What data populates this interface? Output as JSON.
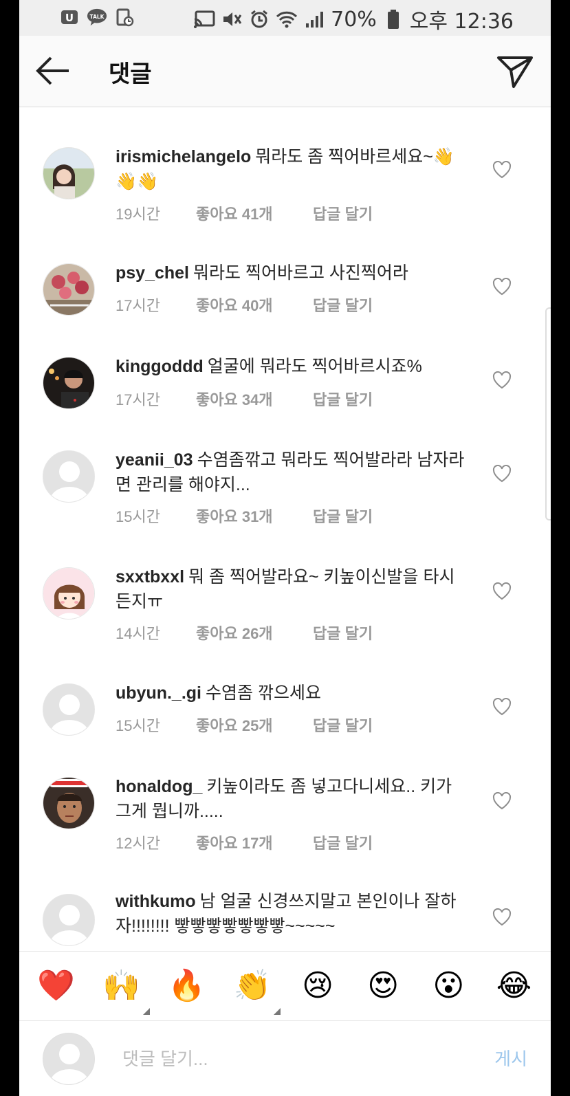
{
  "status_bar": {
    "left_icons": [
      "u-plus-icon",
      "kakaotalk-icon",
      "screen-record-icon"
    ],
    "kakao_label": "TALK",
    "battery_text": "70%",
    "time_text": "오후 12:36"
  },
  "header": {
    "title": "댓글"
  },
  "comments": [
    {
      "username": "irismichelangelo",
      "text": "뭐라도 좀 찍어바르세요~👋👋👋",
      "time": "19시간",
      "likes": "좋아요 41개",
      "reply": "답글 달기",
      "avatar": "photo-woman"
    },
    {
      "username": "psy_chel",
      "text": "뭐라도 찍어바르고 사진찍어라",
      "time": "17시간",
      "likes": "좋아요 40개",
      "reply": "답글 달기",
      "avatar": "photo-flowers"
    },
    {
      "username": "kinggoddd",
      "text": "얼굴에 뭐라도 찍어바르시죠%",
      "time": "17시간",
      "likes": "좋아요 34개",
      "reply": "답글 달기",
      "avatar": "photo-night"
    },
    {
      "username": "yeanii_03",
      "text": "수염좀깎고 뭐라도 찍어발라라 남자라면 관리를 해야지...",
      "time": "15시간",
      "likes": "좋아요 31개",
      "reply": "답글 달기",
      "avatar": "default"
    },
    {
      "username": "sxxtbxxl",
      "text": "뭐 좀 찍어발라요~ 키높이신발을 타시든지ㅠ",
      "time": "14시간",
      "likes": "좋아요 26개",
      "reply": "답글 달기",
      "avatar": "cartoon-girl"
    },
    {
      "username": "ubyun._.gi",
      "text": "수염좀 깎으세요",
      "time": "15시간",
      "likes": "좋아요 25개",
      "reply": "답글 달기",
      "avatar": "default"
    },
    {
      "username": "honaldog_",
      "text": "키높이라도 좀 넣고다니세요.. 키가 그게 뭡니까.....",
      "time": "12시간",
      "likes": "좋아요 17개",
      "reply": "답글 달기",
      "avatar": "photo-man"
    },
    {
      "username": "withkumo",
      "text": "남 얼굴 신경쓰지말고 본인이나 잘하자!!!!!!!! 빻빻빻빻빻빻빻~~~~~",
      "time": "",
      "likes": "",
      "reply": "",
      "avatar": "default"
    }
  ],
  "emoji_bar": [
    "❤️",
    "🙌",
    "🔥",
    "👏",
    "😢",
    "😍",
    "😮",
    "😂"
  ],
  "input": {
    "placeholder": "댓글 달기...",
    "post_label": "게시"
  },
  "colors": {
    "username": "#262626",
    "meta": "#999999",
    "post_button": "#9cc6ec",
    "header_bg": "#fafafa"
  }
}
